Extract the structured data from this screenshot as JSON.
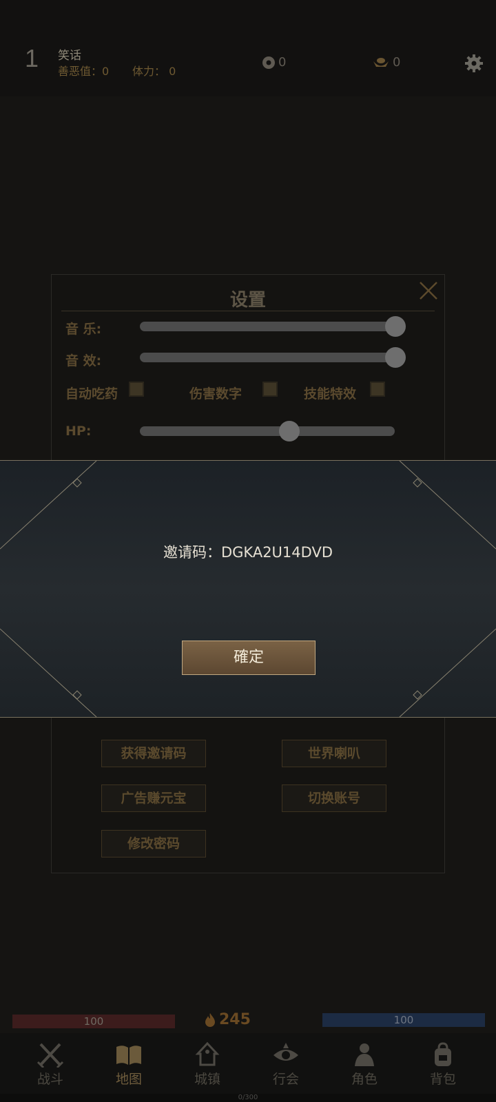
{
  "header": {
    "level": "1",
    "player_name": "笑话",
    "karma_label": "善恶值：0",
    "stamina_label": "体力： 0",
    "coins": "0",
    "ingots": "0"
  },
  "settings": {
    "title": "设置",
    "music_label": "音 乐:",
    "sound_label": "音 效:",
    "music_level": 1.0,
    "sound_level": 1.0,
    "auto_potion_label": "自动吃药",
    "damage_numbers_label": "伤害数字",
    "skill_effects_label": "技能特效",
    "hp_label": "HP:",
    "hp_threshold": 0.6,
    "buttons": {
      "get_invite": "获得邀请码",
      "world_horn": "世界喇叭",
      "ad_earn": "广告赚元宝",
      "switch_account": "切换账号",
      "change_password": "修改密码"
    }
  },
  "dialog": {
    "invite_text": "邀请码：DGKA2U14DVD",
    "confirm_label": "確定"
  },
  "bottom": {
    "hp_value": "100",
    "mp_value": "100",
    "fire_value": "245",
    "xp_text": "0/300",
    "nav": [
      "战斗",
      "地图",
      "城镇",
      "行会",
      "角色",
      "背包"
    ],
    "active_nav": "地图"
  }
}
